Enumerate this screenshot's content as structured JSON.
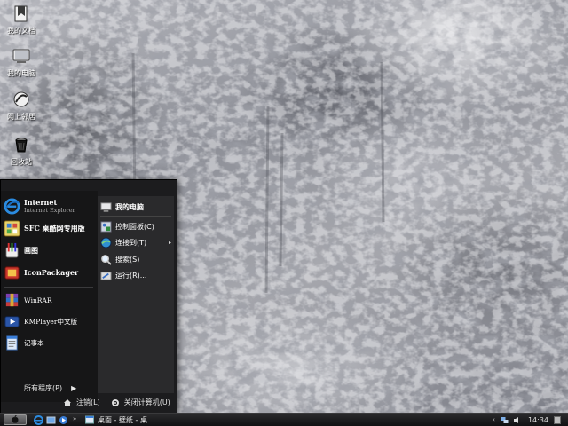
{
  "desktop": {
    "icons": [
      {
        "label": "我的文档",
        "icon": "my-documents-icon"
      },
      {
        "label": "我的电脑",
        "icon": "my-computer-icon"
      },
      {
        "label": "网上邻居",
        "icon": "network-places-icon"
      },
      {
        "label": "回收站",
        "icon": "recycle-bin-icon"
      }
    ]
  },
  "start_menu": {
    "pinned": [
      {
        "label": "Internet",
        "sublabel": "Internet Explorer",
        "icon": "internet-explorer-icon"
      },
      {
        "label": "SFC 桌酷网专用版",
        "icon": "sfc-icon"
      },
      {
        "label": "画图",
        "icon": "paint-icon"
      },
      {
        "label": "IconPackager",
        "icon": "iconpackager-icon"
      }
    ],
    "programs": [
      {
        "label": "WinRAR",
        "icon": "winrar-icon"
      },
      {
        "label": "KMPlayer中文版",
        "icon": "kmplayer-icon"
      },
      {
        "label": "记事本",
        "icon": "notepad-icon"
      }
    ],
    "all_programs": "所有程序(P)",
    "all_programs_arrow": "▶",
    "right": {
      "header": "我的电脑",
      "items": [
        {
          "label": "控制面板(C)",
          "icon": "control-panel-icon"
        },
        {
          "label": "连接到(T)",
          "icon": "connect-to-icon",
          "submenu": "▸"
        },
        {
          "label": "搜索(S)",
          "icon": "search-icon"
        },
        {
          "label": "运行(R)...",
          "icon": "run-icon"
        }
      ]
    },
    "logoff": "注销(L)",
    "shutdown": "关闭计算机(U)"
  },
  "taskbar": {
    "quick_launch_extra": "»",
    "window_title": "桌面 - 壁纸 - 桌...",
    "clock": "14:34"
  },
  "colors": {
    "menu_bg": "#1c1c1e",
    "menu_right_bg": "#2a2a2c",
    "taskbar_bg": "#1a1a1c"
  }
}
